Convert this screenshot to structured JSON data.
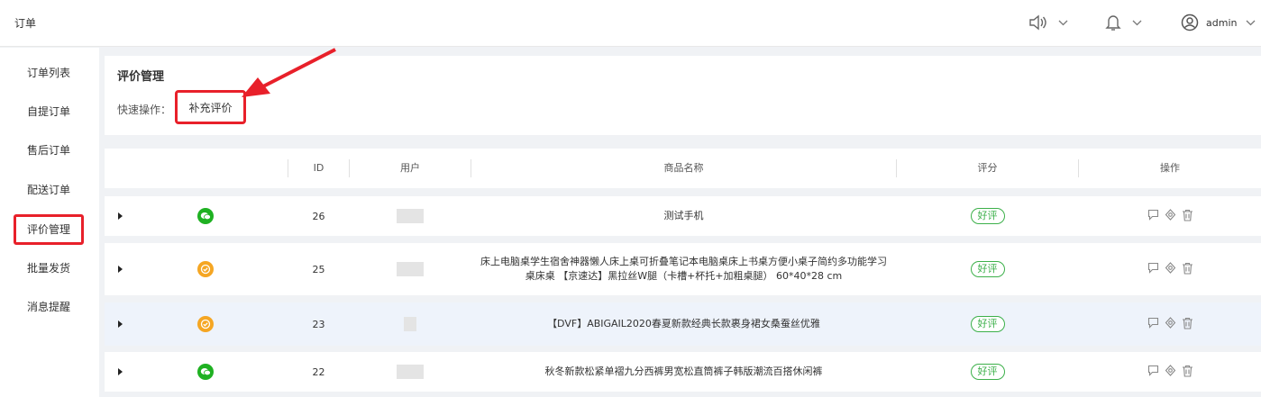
{
  "header": {
    "title": "订单",
    "user": "admin"
  },
  "sidebar": {
    "items": [
      {
        "label": "订单列表"
      },
      {
        "label": "自提订单"
      },
      {
        "label": "售后订单"
      },
      {
        "label": "配送订单"
      },
      {
        "label": "评价管理",
        "active": true
      },
      {
        "label": "批量发货"
      },
      {
        "label": "消息提醒"
      }
    ]
  },
  "panel": {
    "title": "评价管理",
    "quick_label": "快速操作：",
    "quick_button": "补充评价"
  },
  "table": {
    "columns": {
      "id": "ID",
      "user": "用户",
      "product": "商品名称",
      "rating": "评分",
      "actions": "操作"
    },
    "rows": [
      {
        "id": "26",
        "source_icon": "wechat-icon",
        "product": "测试手机",
        "product_line2": "",
        "rating": "好评"
      },
      {
        "id": "25",
        "source_icon": "check-badge-icon",
        "product": "床上电脑桌学生宿舍神器懒人床上桌可折叠笔记本电脑桌床上书桌方便小桌子简约多功能学习",
        "product_line2": "桌床桌 【京速达】黑拉丝W腿（卡槽+杯托+加粗桌腿） 60*40*28 cm",
        "rating": "好评"
      },
      {
        "id": "23",
        "source_icon": "check-badge-icon",
        "product": "【DVF】ABIGAIL2020春夏新款经典长款裹身裙女桑蚕丝优雅",
        "product_line2": "",
        "rating": "好评"
      },
      {
        "id": "22",
        "source_icon": "wechat-icon",
        "product": "秋冬新款松紧单褶九分西裤男宽松直筒裤子韩版潮流百搭休闲裤",
        "product_line2": "",
        "rating": "好评"
      }
    ]
  },
  "colors": {
    "highlight": "#e8202a",
    "good_badge": "#3cb04a",
    "wechat": "#1fb122",
    "other_source": "#f5a623"
  }
}
